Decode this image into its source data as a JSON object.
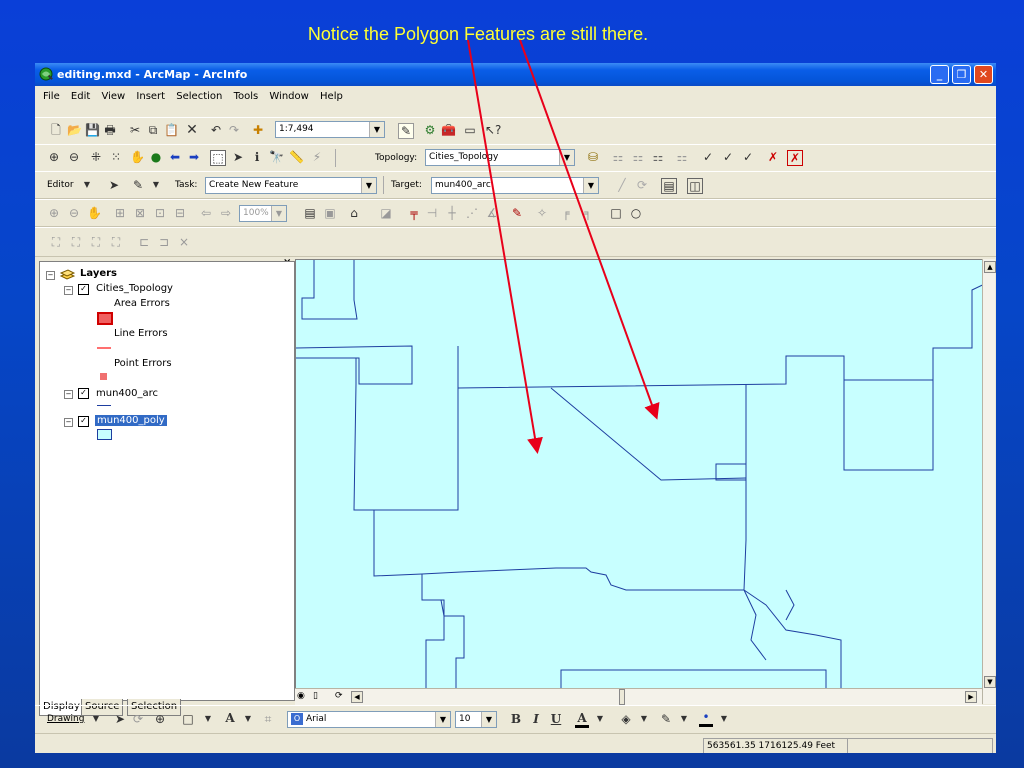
{
  "caption": "Notice the Polygon Features are still there.",
  "window": {
    "title": "editing.mxd - ArcMap - ArcInfo"
  },
  "menu": [
    "File",
    "Edit",
    "View",
    "Insert",
    "Selection",
    "Tools",
    "Window",
    "Help"
  ],
  "standard_toolbar": {
    "scale": "1:7,494"
  },
  "topology_toolbar": {
    "label": "Topology:",
    "value": "Cities_Topology"
  },
  "editor_toolbar": {
    "editor_label": "Editor",
    "task_label": "Task:",
    "task_value": "Create New Feature",
    "target_label": "Target:",
    "target_value": "mun400_arc"
  },
  "zoom_combo": "100%",
  "toc": {
    "root": "Layers",
    "layers": [
      {
        "name": "Cities_Topology",
        "sublabels": [
          "Area Errors",
          "Line Errors",
          "Point Errors"
        ]
      },
      {
        "name": "mun400_arc"
      },
      {
        "name": "mun400_poly",
        "selected": true
      }
    ],
    "tabs": [
      "Display",
      "Source",
      "Selection"
    ]
  },
  "drawing_toolbar": {
    "label": "Drawing",
    "font": "Arial",
    "size": "10",
    "bold": "B",
    "italic": "I",
    "underline": "U",
    "text_a": "A"
  },
  "status": {
    "coords": "563561.35  1716125.49 Feet"
  },
  "colors": {
    "map_fill": "#c8ffff",
    "arrow": "#e8001a",
    "caption": "#ffff33",
    "line": "#1e3ea0"
  }
}
